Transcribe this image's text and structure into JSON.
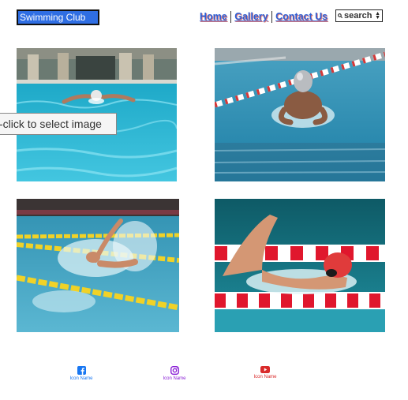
{
  "header": {
    "brand": "Swimming Club",
    "nav": [
      {
        "label": "Home"
      },
      {
        "label": "Gallery"
      },
      {
        "label": "Contact Us"
      }
    ],
    "search_placeholder": "search"
  },
  "gallery": {
    "tooltip": "-click to select image",
    "images": [
      {
        "icon": "butterfly-swimmer-photo"
      },
      {
        "icon": "breaststroke-swimmer-photo"
      },
      {
        "icon": "backstroke-swimmer-photo"
      },
      {
        "icon": "freestyle-swimmer-photo"
      }
    ]
  },
  "footer": {
    "icons": [
      {
        "caption": "Icon Name",
        "icon": "facebook-icon",
        "color": "#1877f2"
      },
      {
        "caption": "Icon Name",
        "icon": "instagram-icon",
        "color": "#8a1fd6"
      },
      {
        "caption": "Icon Name",
        "icon": "youtube-icon",
        "color": "#d92a2a"
      }
    ]
  },
  "colors": {
    "brand": "#2f6ee3",
    "link": "#2d5fd4",
    "pool": "#28b3d0"
  }
}
